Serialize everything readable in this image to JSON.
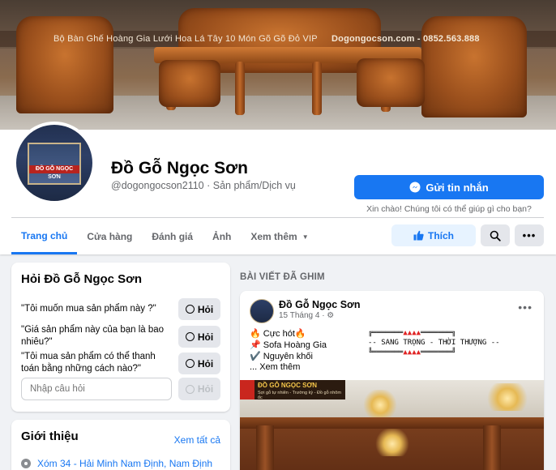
{
  "cover": {
    "caption": "Bộ Bàn Ghế Hoàng Gia Lưới Hoa Lá Tây 10 Món Gõ Gõ Đỏ VIP",
    "contact": "Dogongocson.com - 0852.563.888"
  },
  "profile": {
    "avatar_sign": "ĐỒ GỖ NGỌC SƠN",
    "name": "Đồ Gỗ Ngọc Sơn",
    "handle": "@dogongocson2110",
    "separator": " · ",
    "category": "Sản phẩm/Dịch vụ"
  },
  "message": {
    "button_label": "Gửi tin nhắn",
    "hint": "Xin chào! Chúng tôi có thể giúp gì cho bạn?"
  },
  "tabs": [
    {
      "label": "Trang chủ",
      "active": true
    },
    {
      "label": "Cửa hàng"
    },
    {
      "label": "Đánh giá"
    },
    {
      "label": "Ảnh"
    },
    {
      "label": "Xem thêm"
    }
  ],
  "actions": {
    "like_label": "Thích"
  },
  "ask": {
    "title": "Hỏi Đồ Gỗ Ngọc Sơn",
    "questions": [
      "\"Tôi muốn mua sản phẩm này ?\"",
      "\"Giá sản phẩm này của bạn là bao nhiêu?\"",
      "\"Tôi mua sản phẩm có thể thanh toán bằng những cách nào?\""
    ],
    "ask_label": "Hỏi",
    "input_placeholder": "Nhập câu hỏi"
  },
  "intro": {
    "title": "Giới thiệu",
    "see_all": "Xem tất cả",
    "address": "Xóm 34 - Hải Minh Nam Định, Nam Định"
  },
  "pinned": {
    "section_label": "BÀI VIẾT ĐÃ GHIM",
    "author": "Đồ Gỗ Ngọc Sơn",
    "date": "15 Tháng 4",
    "lines": [
      "🔥 Cực hót🔥",
      "📌 Sofa Hoàng Gia",
      "✔️ Nguyên khối",
      "... Xem thêm"
    ],
    "box_tri": "▲▲▲▲",
    "box_text": "-- SANG TRỌNG - THỜI THƯỢNG --",
    "image_brand": "ĐỒ GỖ NGỌC SƠN",
    "image_tagline": "Sợi gỗ tự nhiên - Trường kỳ - Đồ gỗ nhôm ốc"
  },
  "colors": {
    "brand_blue": "#1877f2",
    "background": "#f0f2f5",
    "secondary_text": "#65676b"
  }
}
